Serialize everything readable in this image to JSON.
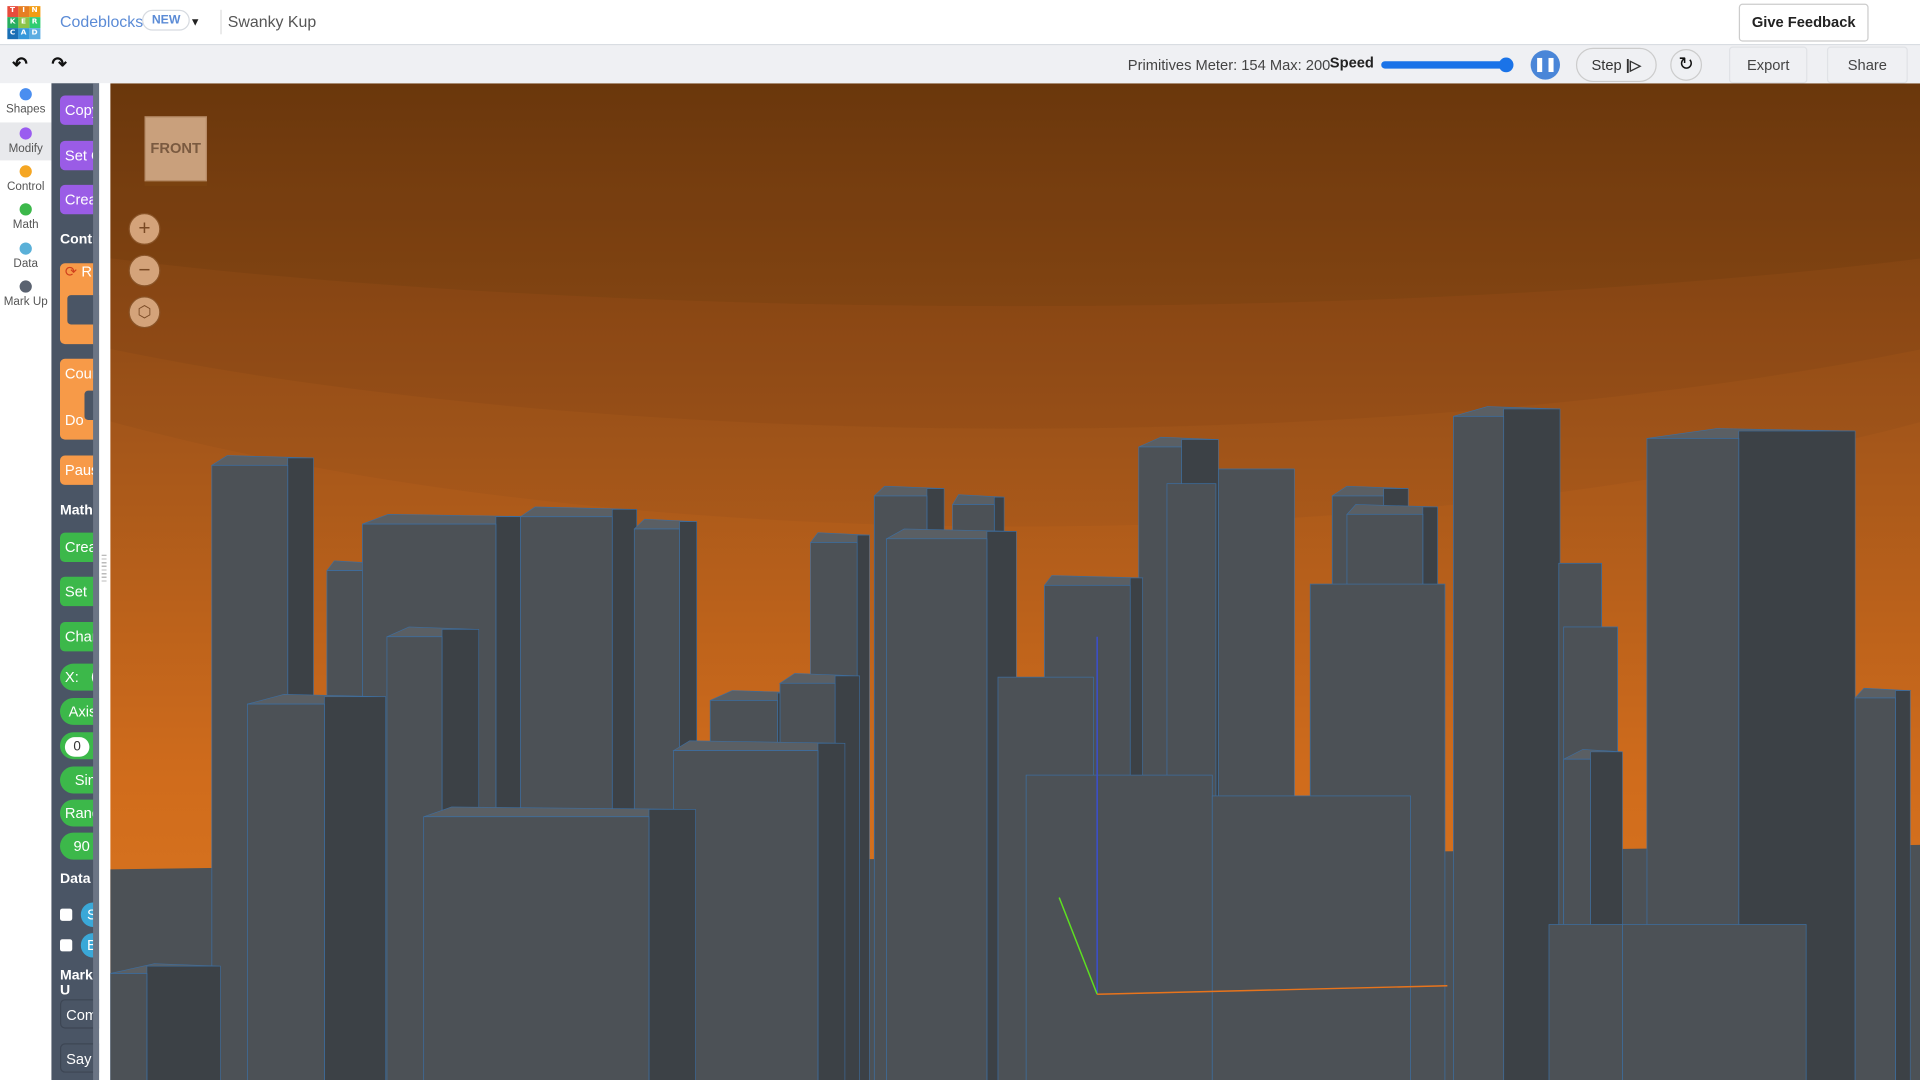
{
  "header": {
    "logo_letters": [
      "T",
      "I",
      "N",
      "K",
      "E",
      "R",
      "C",
      "A",
      "D"
    ],
    "logo_colors": [
      "#e74c3c",
      "#e67e22",
      "#f39c12",
      "#27ae60",
      "#8bc34a",
      "#2ecc71",
      "#1a6fb5",
      "#3498db",
      "#5dade2"
    ],
    "app_name": "Codeblocks",
    "badge": "NEW",
    "project_name": "Swanky Kup",
    "feedback_label": "Give Feedback"
  },
  "toolbar": {
    "undo_icon": "undo-arrow",
    "redo_icon": "redo-arrow",
    "primitives_meter": "Primitives Meter: 154 Max: 200",
    "speed_label": "Speed",
    "speed_value": 1.0,
    "step_label": "Step",
    "export_label": "Export",
    "share_label": "Share"
  },
  "categories": [
    {
      "label": "Shapes",
      "color": "#4a8ef0"
    },
    {
      "label": "Modify",
      "color": "#9a5cf0"
    },
    {
      "label": "Control",
      "color": "#f5a623"
    },
    {
      "label": "Math",
      "color": "#3cb84a"
    },
    {
      "label": "Data",
      "color": "#5ab0d8"
    },
    {
      "label": "Mark Up",
      "color": "#5a6270"
    }
  ],
  "palette": {
    "modify_blocks": [
      "Copy",
      "Set C",
      "Creat"
    ],
    "control_heading": "Contro",
    "control_blocks": [
      "R",
      "Count",
      "Do",
      "Pause"
    ],
    "math_heading": "Math",
    "math_blocks": [
      "Creat",
      "Set",
      "Chan",
      "X:",
      "Axis",
      "0",
      "Sin",
      "Rand",
      "90"
    ],
    "data_heading": "Data",
    "data_blocks": [
      "St",
      "Ba"
    ],
    "markup_heading": "Mark U",
    "markup_blocks": [
      "Comm",
      "Say"
    ]
  },
  "viewport": {
    "view_cube_label": "FRONT",
    "sky_colors": [
      "#7a400f",
      "#d9731c"
    ],
    "building_color": "#4a4f54"
  }
}
